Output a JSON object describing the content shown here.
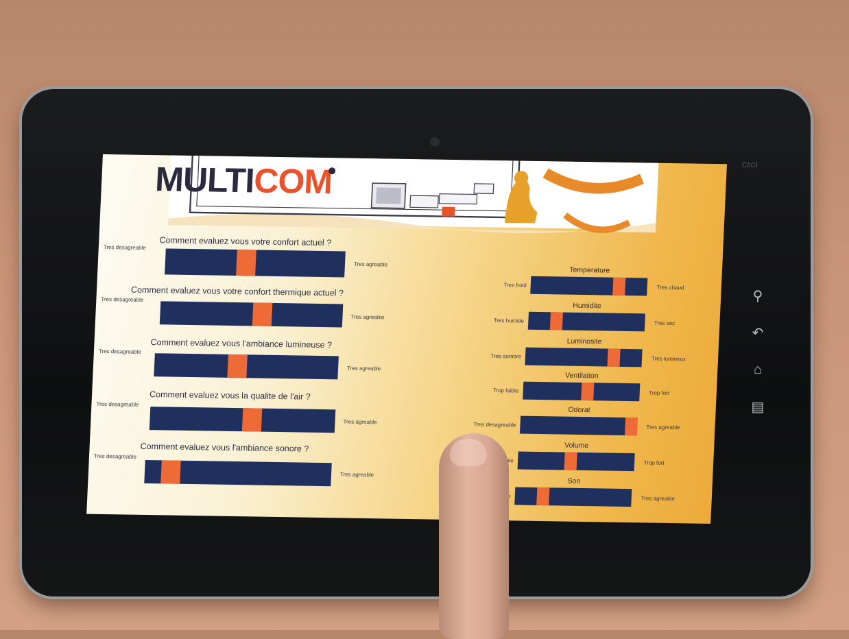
{
  "header": {
    "logo_main": "MULTI",
    "logo_accent": "COM",
    "monitor_label": "MULTICOM"
  },
  "questions": [
    {
      "question": "Comment evaluez vous votre confort actuel ?",
      "left": "Tres desagreable",
      "right": "Tres agreable",
      "value": 0.45
    },
    {
      "question": "Comment evaluez vous votre confort thermique actuel ?",
      "left": "Tres desagreable",
      "right": "Tres agreable",
      "value": 0.56
    },
    {
      "question": "Comment evaluez vous l'ambiance lumineuse ?",
      "left": "Tres desagreable",
      "right": "Tres agreable",
      "value": 0.45
    },
    {
      "question": "Comment evaluez vous la qualite de l'air ?",
      "left": "Tres desagreable",
      "right": "Tres agreable",
      "value": 0.55
    },
    {
      "question": "Comment evaluez vous l'ambiance sonore ?",
      "left": "Tres desagreable",
      "right": "Tres agreable",
      "value": 0.14
    }
  ],
  "sensations": [
    {
      "title": "Temperature",
      "left": "Tres froid",
      "right": "Tres chaud",
      "value": 0.76
    },
    {
      "title": "Humidite",
      "left": "Tres humide",
      "right": "Tres sec",
      "value": 0.24
    },
    {
      "title": "Luminosite",
      "left": "Tres sombre",
      "right": "Tres lumineux",
      "value": 0.76
    },
    {
      "title": "Ventilation",
      "left": "Trop faible",
      "right": "Trop fort",
      "value": 0.55
    },
    {
      "title": "Odorat",
      "left": "Tres desagreable",
      "right": "Tres agreable",
      "value": 0.95
    },
    {
      "title": "Volume",
      "left": "Trop faible",
      "right": "Trop fort",
      "value": 0.45
    },
    {
      "title": "Son",
      "left": "Tres desagreable",
      "right": "Tres agreable",
      "value": 0.24
    }
  ],
  "tablet": {
    "status_text": "C/ICI"
  }
}
